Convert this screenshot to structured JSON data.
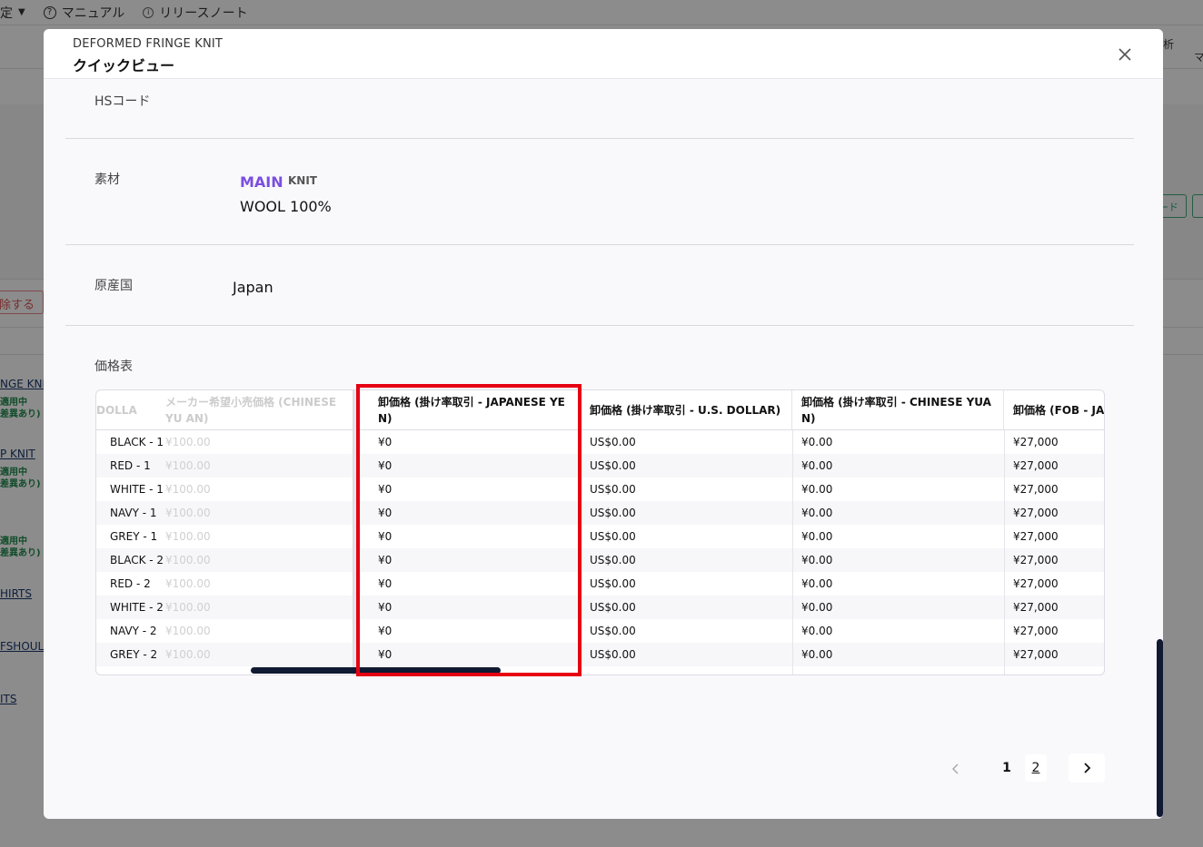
{
  "background": {
    "topbar": {
      "settings_label": "設定",
      "manual_label": "マニュアル",
      "release_notes_label": "リリースノート"
    },
    "right_panel": {
      "analysis_label": "析",
      "ma_label": "マ",
      "button_label": "ード"
    },
    "left_items": {
      "remove_label": "除する",
      "item1": "NGE KNIT",
      "item1_badge1": "適用中",
      "item1_badge2": "差異あり)",
      "item2": "P KNIT",
      "item2_badge1": "適用中",
      "item2_badge2": "差異あり)",
      "item3_badge1": "適用中",
      "item3_badge2": "差異あり)",
      "item4": "HIRTS",
      "item5": "FSHOULD",
      "item6": "ITS"
    }
  },
  "modal": {
    "subtitle": "DEFORMED FRINGE KNIT",
    "title": "クイックビュー",
    "hs_code_label": "HSコード",
    "material_label": "素材",
    "material_main": "MAIN",
    "material_type": "KNIT",
    "material_value": "WOOL 100%",
    "origin_label": "原産国",
    "origin_value": "Japan",
    "price_table_label": "価格表"
  },
  "table": {
    "headers": {
      "col0": "DOLLA",
      "col1": "メーカー希望小売価格 (CHINESE YU AN)",
      "col2": "卸価格 (掛け率取引 - JAPANESE YE N)",
      "col3": "卸価格 (掛け率取引 - U.S. DOLLAR)",
      "col4": "卸価格 (掛け率取引 - CHINESE YUA N)",
      "col5": "卸価格 (FOB - JAPA"
    },
    "rows": [
      {
        "name": "BLACK - 1",
        "retail": "¥100.00",
        "jpy": "¥0",
        "usd": "US$0.00",
        "cny": "¥0.00",
        "fob": "¥27,000"
      },
      {
        "name": "RED - 1",
        "retail": "¥100.00",
        "jpy": "¥0",
        "usd": "US$0.00",
        "cny": "¥0.00",
        "fob": "¥27,000"
      },
      {
        "name": "WHITE - 1",
        "retail": "¥100.00",
        "jpy": "¥0",
        "usd": "US$0.00",
        "cny": "¥0.00",
        "fob": "¥27,000"
      },
      {
        "name": "NAVY - 1",
        "retail": "¥100.00",
        "jpy": "¥0",
        "usd": "US$0.00",
        "cny": "¥0.00",
        "fob": "¥27,000"
      },
      {
        "name": "GREY - 1",
        "retail": "¥100.00",
        "jpy": "¥0",
        "usd": "US$0.00",
        "cny": "¥0.00",
        "fob": "¥27,000"
      },
      {
        "name": "BLACK - 2",
        "retail": "¥100.00",
        "jpy": "¥0",
        "usd": "US$0.00",
        "cny": "¥0.00",
        "fob": "¥27,000"
      },
      {
        "name": "RED - 2",
        "retail": "¥100.00",
        "jpy": "¥0",
        "usd": "US$0.00",
        "cny": "¥0.00",
        "fob": "¥27,000"
      },
      {
        "name": "WHITE - 2",
        "retail": "¥100.00",
        "jpy": "¥0",
        "usd": "US$0.00",
        "cny": "¥0.00",
        "fob": "¥27,000"
      },
      {
        "name": "NAVY - 2",
        "retail": "¥100.00",
        "jpy": "¥0",
        "usd": "US$0.00",
        "cny": "¥0.00",
        "fob": "¥27,000"
      },
      {
        "name": "GREY - 2",
        "retail": "¥100.00",
        "jpy": "¥0",
        "usd": "US$0.00",
        "cny": "¥0.00",
        "fob": "¥27,000"
      }
    ]
  },
  "pagination": {
    "page1": "1",
    "page2": "2"
  },
  "icons": {
    "close": "close-icon",
    "prev": "chevron-left-icon",
    "next": "chevron-right-icon",
    "help": "question-circle-icon",
    "info": "info-circle-icon",
    "caret": "caret-down-icon"
  },
  "colors": {
    "accent_purple": "#7b4fe0",
    "highlight_red": "#e60012",
    "scrollbar_navy": "#111a33"
  }
}
